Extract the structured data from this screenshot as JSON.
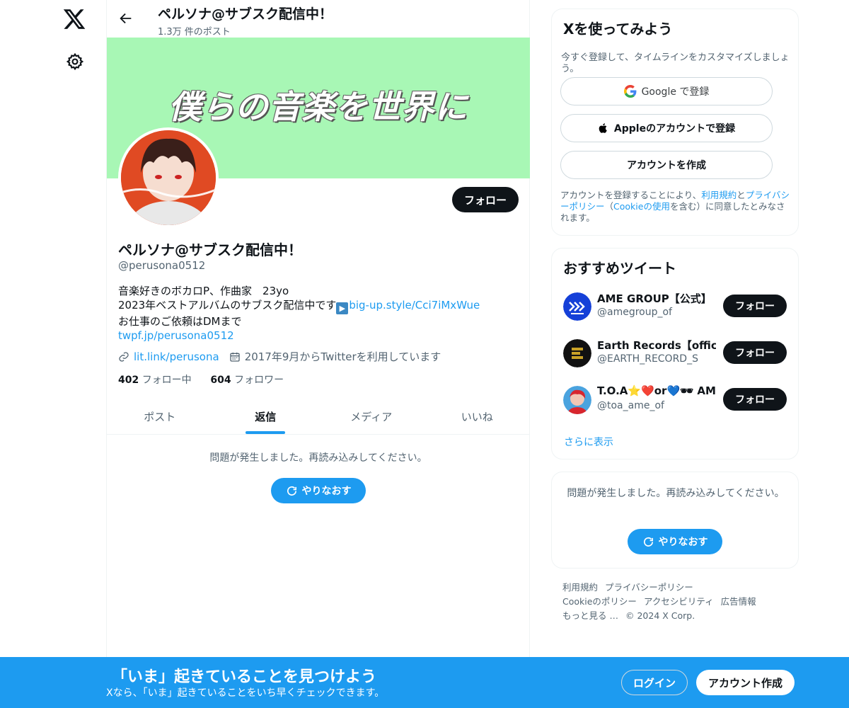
{
  "header": {
    "title": "ペルソナ@サブスク配信中！",
    "post_count": "1.3万 件のポスト"
  },
  "banner": {
    "text": "僕らの音楽を世界に",
    "background": "#a8f7b5"
  },
  "profile": {
    "follow_label": "フォロー",
    "name": "ペルソナ@サブスク配信中！",
    "handle": "@perusona0512",
    "bio_line1": "音楽好きのボカロP、作曲家　23yo",
    "bio_line2_text": "2023年ベストアルバムのサブスク配信中です",
    "bio_line2_link": "big-up.style/Cci7iMxWue",
    "bio_line3": "お仕事のご依頼はDMまで",
    "bio_line4_link": "twpf.jp/perusona0512",
    "website": "lit.link/perusona",
    "joined": "2017年9月からTwitterを利用しています",
    "following_count": "402",
    "following_label": "フォロー中",
    "followers_count": "604",
    "followers_label": "フォロワー"
  },
  "tabs": [
    {
      "label": "ポスト",
      "active": false
    },
    {
      "label": "返信",
      "active": true
    },
    {
      "label": "メディア",
      "active": false
    },
    {
      "label": "いいね",
      "active": false
    }
  ],
  "feed": {
    "error": "問題が発生しました。再読み込みしてください。",
    "retry_label": "やりなおす"
  },
  "signup_card": {
    "title": "Xを使ってみよう",
    "subtitle": "今すぐ登録して、タイムラインをカスタマイズしましょう。",
    "google_label": "Google で登録",
    "apple_label": "Appleのアカウントで登録",
    "create_label": "アカウントを作成",
    "legal_prefix": "アカウントを登録することにより、",
    "terms_link": "利用規約",
    "legal_and": "と",
    "privacy_link": "プライバシーポリシー",
    "legal_paren_open": "（",
    "cookie_link": "Cookieの使用",
    "legal_suffix": "を含む）に同意したとみなされます。"
  },
  "recommendations": {
    "title": "おすすめツイート",
    "items": [
      {
        "name": "AME GROUP【公式】",
        "handle": "@amegroup_of",
        "follow_label": "フォロー",
        "avatar_icon": "ame-group-logo-icon"
      },
      {
        "name": "Earth Records【official",
        "handle": "@EARTH_RECORD_S",
        "follow_label": "フォロー",
        "avatar_icon": "earth-records-logo-icon"
      },
      {
        "name": "T.O.A⭐❤️or💙🕶 AME",
        "handle": "@toa_ame_of",
        "follow_label": "フォロー",
        "avatar_icon": "toa-avatar-icon"
      }
    ],
    "more_label": "さらに表示"
  },
  "side_error": {
    "message": "問題が発生しました。再読み込みしてください。",
    "retry_label": "やりなおす"
  },
  "footer": {
    "links": [
      "利用規約",
      "プライバシーポリシー",
      "Cookieのポリシー",
      "アクセシビリティ",
      "広告情報",
      "もっと見る …"
    ],
    "copyright": "© 2024 X Corp."
  },
  "bottom_bar": {
    "title": "「いま」起きていることを見つけよう",
    "subtitle": "Xなら、「いま」起きていることをいち早くチェックできます。",
    "login_label": "ログイン",
    "signup_label": "アカウント作成",
    "background": "#1d9bf0"
  }
}
